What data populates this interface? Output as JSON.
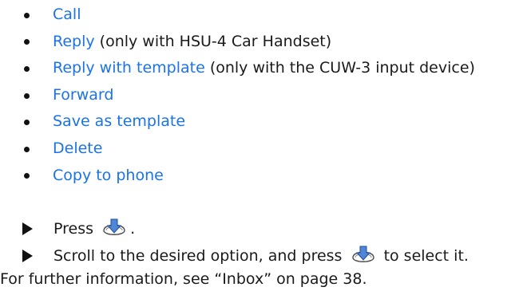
{
  "options": [
    {
      "link": "Call",
      "note": ""
    },
    {
      "link": "Reply",
      "note": " (only with HSU-4 Car Handset)"
    },
    {
      "link": "Reply with template",
      "note": " (only with the CUW-3 input device)"
    },
    {
      "link": "Forward",
      "note": ""
    },
    {
      "link": "Save as template",
      "note": ""
    },
    {
      "link": "Delete",
      "note": ""
    },
    {
      "link": "Copy to phone",
      "note": ""
    }
  ],
  "steps": {
    "step1_text": "Press",
    "step1_suffix": ".",
    "step2_before": "Scroll to the desired option, and press",
    "step2_after": "to select it.",
    "icon": "scroll-key-icon"
  },
  "info": {
    "text": "For further information, see “Inbox” on page 38."
  },
  "colors": {
    "link": "#1a73e8",
    "text": "#1a1a1a"
  }
}
